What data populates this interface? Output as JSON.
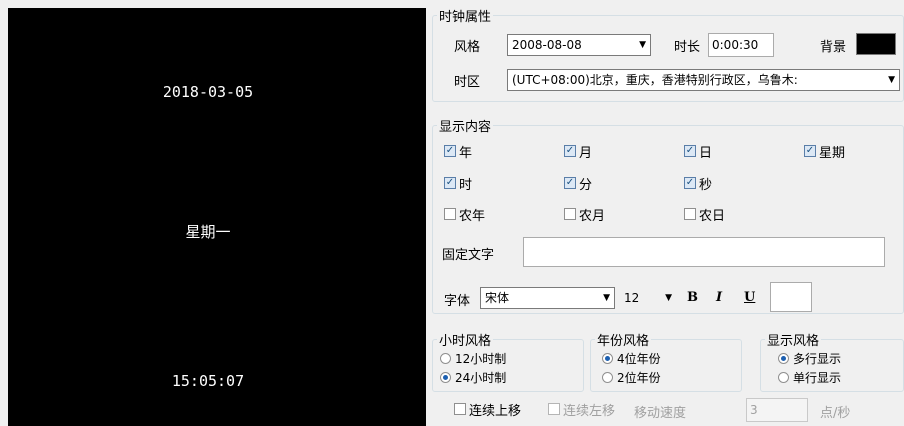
{
  "preview": {
    "date": "2018-03-05",
    "weekday": "星期一",
    "time": "15:05:07"
  },
  "clock_props": {
    "legend": "时钟属性",
    "style_label": "风格",
    "style_value": "2008-08-08",
    "duration_label": "时长",
    "duration_value": "0:00:30",
    "background_label": "背景",
    "background_color": "#000000",
    "timezone_label": "时区",
    "timezone_value": "(UTC+08:00)北京，重庆，香港特别行政区，乌鲁木:"
  },
  "display_content": {
    "legend": "显示内容",
    "items": [
      {
        "label": "年",
        "checked": true
      },
      {
        "label": "月",
        "checked": true
      },
      {
        "label": "日",
        "checked": true
      },
      {
        "label": "星期",
        "checked": true
      },
      {
        "label": "时",
        "checked": true
      },
      {
        "label": "分",
        "checked": true
      },
      {
        "label": "秒",
        "checked": true
      },
      {
        "label": "农年",
        "checked": false
      },
      {
        "label": "农月",
        "checked": false
      },
      {
        "label": "农日",
        "checked": false
      }
    ],
    "fixed_text_label": "固定文字",
    "fixed_text_value": "",
    "font_label": "字体",
    "font_value": "宋体",
    "font_size": "12",
    "bold_label": "B",
    "italic_label": "I",
    "underline_label": "U"
  },
  "hour_style": {
    "legend": "小时风格",
    "opt12": "12小时制",
    "opt24": "24小时制",
    "selected": "24"
  },
  "year_style": {
    "legend": "年份风格",
    "opt4": "4位年份",
    "opt2": "2位年份",
    "selected": "4"
  },
  "display_style": {
    "legend": "显示风格",
    "multi": "多行显示",
    "single": "单行显示",
    "selected": "multi"
  },
  "bottom": {
    "scroll_up": "连续上移",
    "scroll_left": "连续左移",
    "speed_label": "移动速度",
    "speed_value": "3",
    "speed_unit": "点/秒"
  }
}
